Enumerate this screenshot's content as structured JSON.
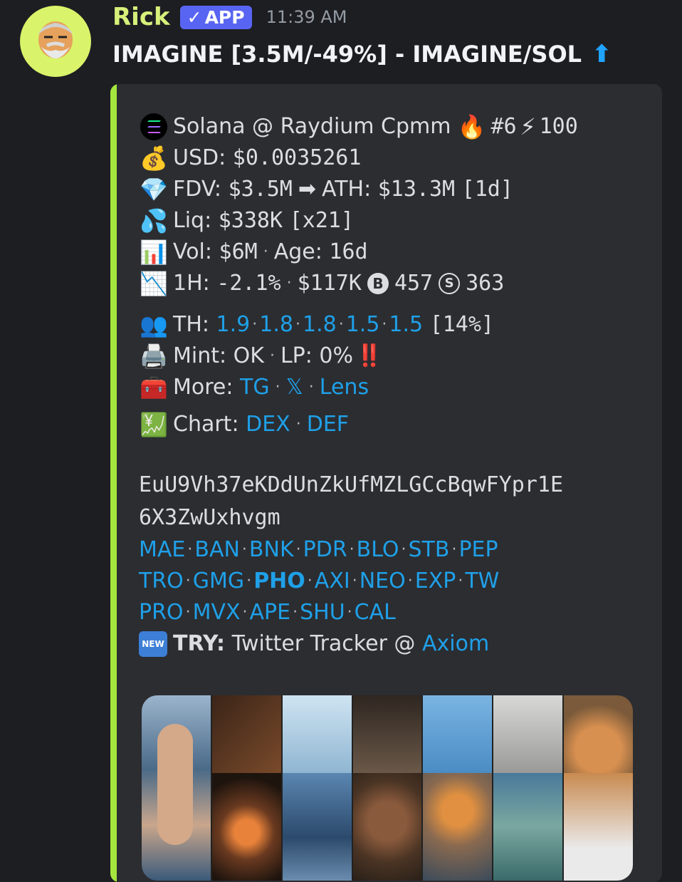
{
  "message": {
    "author": "Rick",
    "badge": "APP",
    "timestamp": "11:39 AM",
    "title": "IMAGINE [3.5M/-49%] - IMAGINE/SOL",
    "title_icon": "up-arrow-icon"
  },
  "embed": {
    "accent_color": "#a4e63e",
    "chain_line": {
      "chain": "Solana @ Raydium Cpmm",
      "rank": "#6",
      "score": "100"
    },
    "usd_line": {
      "label": "USD:",
      "value": "$0.0035261"
    },
    "fdv_line": {
      "label": "FDV:",
      "value": "$3.5M",
      "ath_label": "ATH:",
      "ath_value": "$13.3M",
      "ath_age": "[1d]"
    },
    "liq_line": {
      "label": "Liq:",
      "value": "$338K",
      "multiplier": "[x21]"
    },
    "vol_line": {
      "label": "Vol:",
      "value": "$6M",
      "age_label": "Age:",
      "age_value": "16d"
    },
    "h1_line": {
      "label": "1H:",
      "change": "-2.1%",
      "volume": "$117K",
      "buy_symbol": "B",
      "buys": "457",
      "sell_symbol": "S",
      "sells": "363"
    },
    "th_line": {
      "label": "TH:",
      "values": [
        "1.9",
        "1.8",
        "1.8",
        "1.5",
        "1.5"
      ],
      "total": "[14%]"
    },
    "mint_line": {
      "mint_label": "Mint:",
      "mint_value": "OK",
      "lp_label": "LP:",
      "lp_value": "0%",
      "alert": "‼️"
    },
    "more_line": {
      "label": "More:",
      "links": [
        "TG",
        "𝕏",
        "Lens"
      ]
    },
    "chart_line": {
      "label": "Chart:",
      "links": [
        "DEX",
        "DEF"
      ]
    },
    "address": {
      "line1": "EuU9Vh37eKDdUnZkUfMZLGCcBqwFYpr1E",
      "line2": "6X3ZwUxhvgm"
    },
    "platform_rows": [
      [
        "MAE",
        "BAN",
        "BNK",
        "PDR",
        "BLO",
        "STB",
        "PEP"
      ],
      [
        "TRO",
        "GMG",
        "PHO",
        "AXI",
        "NEO",
        "EXP",
        "TW"
      ],
      [
        "PRO",
        "MVX",
        "APE",
        "SHU",
        "CAL"
      ]
    ],
    "highlighted_platform": "PHO",
    "try_line": {
      "badge": "NEW",
      "label": "TRY:",
      "text": "Twitter Tracker @",
      "link": "Axiom"
    }
  },
  "colors": {
    "background": "#1d1e22",
    "embed_bg": "#2b2d31",
    "author": "#d6f07a",
    "link": "#1fa0e8",
    "app_badge": "#5865f2"
  }
}
